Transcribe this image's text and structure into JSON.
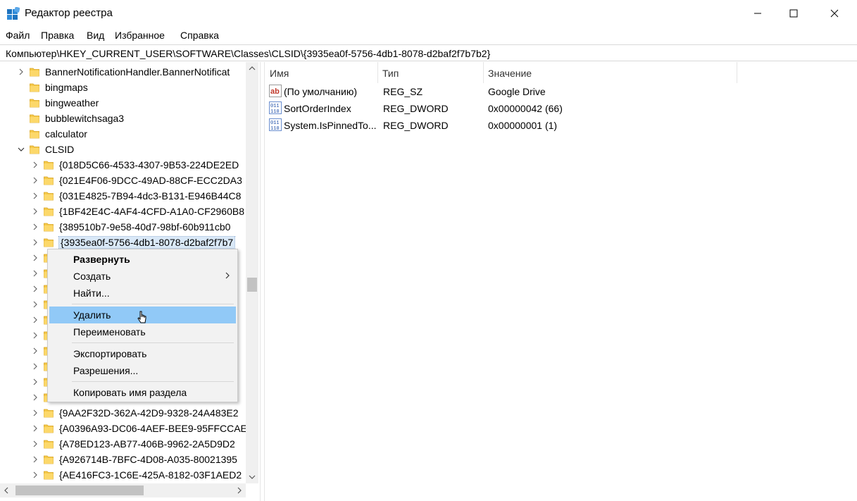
{
  "window": {
    "title": "Редактор реестра",
    "accent": "#0078d7"
  },
  "menu": [
    "Файл",
    "Правка",
    "Вид",
    "Избранное",
    "Справка"
  ],
  "address": "Компьютер\\HKEY_CURRENT_USER\\SOFTWARE\\Classes\\CLSID\\{3935ea0f-5756-4db1-8078-d2baf2f7b7b2}",
  "tree": {
    "parent_items": [
      {
        "label": "BannerNotificationHandler.BannerNotificat",
        "expandable": true
      },
      {
        "label": "bingmaps",
        "expandable": false
      },
      {
        "label": "bingweather",
        "expandable": false
      },
      {
        "label": "bubblewitchsaga3",
        "expandable": false
      },
      {
        "label": "calculator",
        "expandable": false
      },
      {
        "label": "CLSID",
        "expandable": true,
        "expanded": true
      }
    ],
    "clsid_items": [
      "{018D5C66-4533-4307-9B53-224DE2ED",
      "{021E4F06-9DCC-49AD-88CF-ECC2DA3",
      "{031E4825-7B94-4dc3-B131-E946B44C8",
      "{1BF42E4C-4AF4-4CFD-A1A0-CF2960B8",
      "{389510b7-9e58-40d7-98bf-60b911cb0",
      "{3935ea0f-5756-4db1-8078-d2baf2f7b7",
      "E",
      "E",
      "60",
      "E9",
      "E",
      "C",
      "0D",
      "8",
      "57",
      "0",
      "{9AA2F32D-362A-42D9-9328-24A483E2",
      "{A0396A93-DC06-4AEF-BEE9-95FFCCAE",
      "{A78ED123-AB77-406B-9962-2A5D9D2",
      "{A926714B-7BFC-4D08-A035-80021395",
      "{AE416FC3-1C6E-425A-8182-03F1AED2"
    ],
    "selected_index": 5
  },
  "list": {
    "columns": [
      "Имя",
      "Тип",
      "Значение"
    ],
    "rows": [
      {
        "icon": "string-value-icon",
        "name": "(По умолчанию)",
        "type": "REG_SZ",
        "value": "Google Drive"
      },
      {
        "icon": "binary-value-icon",
        "name": "SortOrderIndex",
        "type": "REG_DWORD",
        "value": "0x00000042 (66)"
      },
      {
        "icon": "binary-value-icon",
        "name": "System.IsPinnedTo...",
        "type": "REG_DWORD",
        "value": "0x00000001 (1)"
      }
    ]
  },
  "context_menu": {
    "items": [
      {
        "label": "Развернуть",
        "bold": true
      },
      {
        "label": "Создать",
        "submenu": true
      },
      {
        "label": "Найти..."
      },
      {
        "label": "Удалить",
        "highlighted": true
      },
      {
        "label": "Переименовать"
      },
      {
        "label": "Экспортировать"
      },
      {
        "label": "Разрешения..."
      },
      {
        "label": "Копировать имя раздела"
      }
    ]
  }
}
